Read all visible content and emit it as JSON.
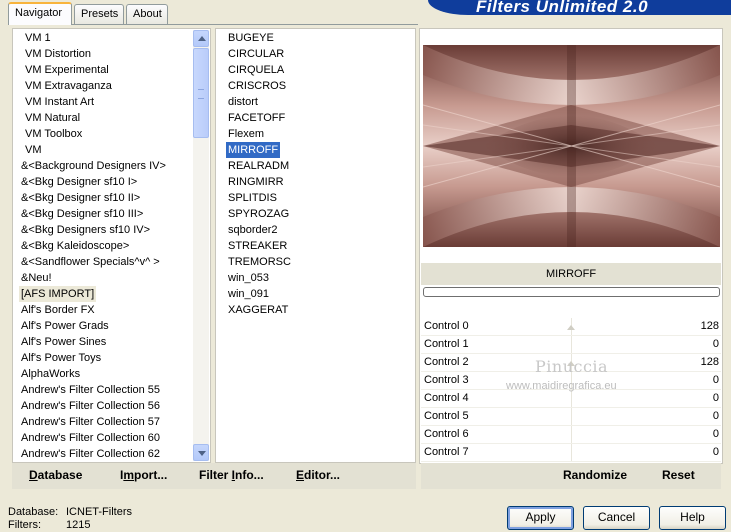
{
  "tabs": [
    "Navigator",
    "Presets",
    "About"
  ],
  "banner_title": "Filters Unlimited 2.0",
  "categories": [
    "VM 1",
    "VM Distortion",
    "VM Experimental",
    "VM Extravaganza",
    "VM Instant Art",
    "VM Natural",
    "VM Toolbox",
    "VM",
    "&<Background Designers IV>",
    "&<Bkg Designer sf10 I>",
    "&<Bkg Designer sf10 II>",
    "&<Bkg Designer sf10 III>",
    "&<Bkg Designers sf10 IV>",
    "&<Bkg Kaleidoscope>",
    "&<Sandflower Specials^v^ >",
    "&Neu!",
    "[AFS IMPORT]",
    "Alf's Border FX",
    "Alf's Power Grads",
    "Alf's Power Sines",
    "Alf's Power Toys",
    "AlphaWorks",
    "Andrew's Filter Collection 55",
    "Andrew's Filter Collection 56",
    "Andrew's Filter Collection 57",
    "Andrew's Filter Collection 60",
    "Andrew's Filter Collection 62"
  ],
  "selected_category": "[AFS IMPORT]",
  "filters": [
    "BUGEYE",
    "CIRCULAR",
    "CIRQUELA",
    "CRISCROS",
    "distort",
    "FACETOFF",
    "Flexem",
    "MIRROFF",
    "REALRADM",
    "RINGMIRR",
    "SPLITDIS",
    "SPYROZAG",
    "sqborder2",
    "STREAKER",
    "TREMORSC",
    "win_053",
    "win_091",
    "XAGGERAT"
  ],
  "selected_filter": "MIRROFF",
  "left_buttons": {
    "database": {
      "u": "D",
      "rest": "atabase"
    },
    "import": {
      "pre": "I",
      "u": "m",
      "rest": "port..."
    },
    "filter_info": {
      "pre": "Filter ",
      "u": "I",
      "rest": "nfo..."
    },
    "editor": {
      "u": "E",
      "rest": "ditor..."
    }
  },
  "preview_filter_name": "MIRROFF",
  "controls": [
    {
      "label": "Control 0",
      "value": "128",
      "level": 0.5
    },
    {
      "label": "Control 1",
      "value": "0",
      "level": 0
    },
    {
      "label": "Control 2",
      "value": "128",
      "level": 0.5
    },
    {
      "label": "Control 3",
      "value": "0",
      "level": 0
    },
    {
      "label": "Control 4",
      "value": "0",
      "level": 0
    },
    {
      "label": "Control 5",
      "value": "0",
      "level": 0
    },
    {
      "label": "Control 6",
      "value": "0",
      "level": 0
    },
    {
      "label": "Control 7",
      "value": "0",
      "level": 0
    }
  ],
  "right_buttons": {
    "randomize": "Randomize",
    "reset": "Reset"
  },
  "watermark": {
    "name": "Pinuccia",
    "url": "www.maidiregrafica.eu"
  },
  "status": {
    "database_label": "Database:",
    "database_value": "ICNET-Filters",
    "filters_label": "Filters:",
    "filters_value": "1215"
  },
  "dialog_buttons": {
    "apply": "Apply",
    "cancel": "Cancel",
    "help": "Help"
  },
  "colors": {
    "selection": "#316ac5",
    "banner": "#0f3d9c",
    "preview_base": "#a57a70"
  }
}
